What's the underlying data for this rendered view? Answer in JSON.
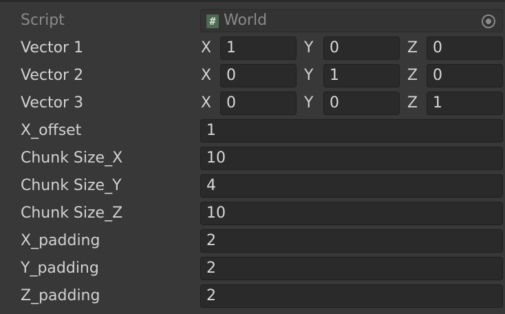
{
  "script": {
    "label": "Script",
    "icon": "csharp-script-icon",
    "value": "World"
  },
  "vectors": [
    {
      "label": "Vector 1",
      "x_label": "X",
      "y_label": "Y",
      "z_label": "Z",
      "x": "1",
      "y": "0",
      "z": "0"
    },
    {
      "label": "Vector 2",
      "x_label": "X",
      "y_label": "Y",
      "z_label": "Z",
      "x": "0",
      "y": "1",
      "z": "0"
    },
    {
      "label": "Vector 3",
      "x_label": "X",
      "y_label": "Y",
      "z_label": "Z",
      "x": "0",
      "y": "0",
      "z": "1"
    }
  ],
  "fields": [
    {
      "label": "X_offset",
      "value": "1"
    },
    {
      "label": "Chunk Size_X",
      "value": "10"
    },
    {
      "label": "Chunk Size_Y",
      "value": "4"
    },
    {
      "label": "Chunk Size_Z",
      "value": "10"
    },
    {
      "label": "X_padding",
      "value": "2"
    },
    {
      "label": "Y_padding",
      "value": "2"
    },
    {
      "label": "Z_padding",
      "value": "2"
    }
  ]
}
